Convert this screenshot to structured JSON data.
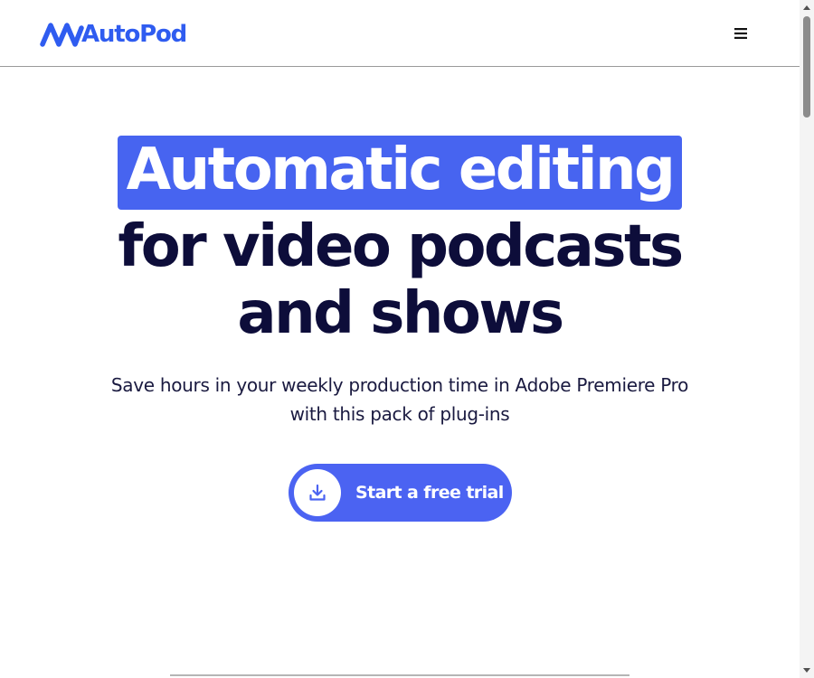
{
  "header": {
    "logo_text": "AutoPod",
    "brand_color": "#2f5cf0",
    "menu_icon": "hamburger-menu-icon"
  },
  "hero": {
    "title_highlight": "Automatic editing",
    "title_line2": "for video podcasts",
    "title_line3": "and shows",
    "subtitle": "Save hours in your weekly production time in Adobe Premiere Pro with this pack of plug-ins",
    "highlight_color": "#4764f0",
    "title_color": "#0d0d3a"
  },
  "cta": {
    "label": "Start a free trial",
    "icon": "download-icon",
    "color": "#4b63f2"
  }
}
